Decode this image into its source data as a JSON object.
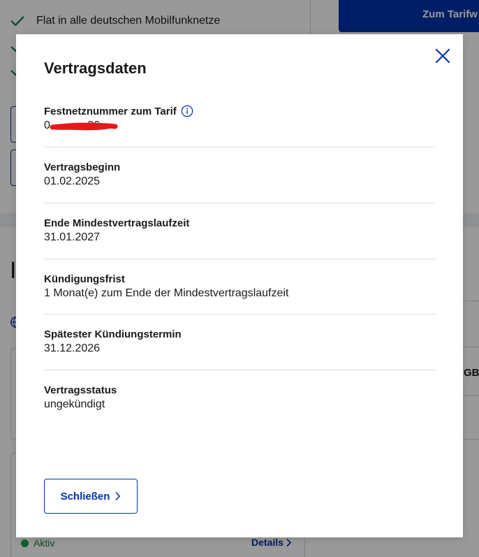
{
  "background": {
    "features": [
      "Flat in alle deutschen Mobilfunknetze"
    ],
    "tariff_button_label": "Zum Tarifw",
    "heading_fragment": "I",
    "gb_fragment": "GB",
    "status_label": "Aktiv",
    "details_link": "Details"
  },
  "modal": {
    "title": "Vertragsdaten",
    "fields": [
      {
        "label": "Festnetznummer zum Tarif",
        "value": "0            26"
      },
      {
        "label": "Vertragsbeginn",
        "value": "01.02.2025"
      },
      {
        "label": "Ende Mindestvertragslaufzeit",
        "value": "31.01.2027"
      },
      {
        "label": "Kündigungsfrist",
        "value": "1 Monat(e) zum Ende der Mindestvertragslaufzeit"
      },
      {
        "label": "Spätester Kündiungstermin",
        "value": "31.12.2026"
      },
      {
        "label": "Vertragsstatus",
        "value": "ungekündigt"
      }
    ],
    "close_button_label": "Schließen"
  },
  "colors": {
    "brand_blue": "#0033a9",
    "check_green": "#1a7f5a",
    "status_green": "#1a9e45",
    "redaction_red": "#e8161b"
  },
  "icons": {
    "close": "close-icon",
    "info": "info-icon",
    "check": "check-icon",
    "chevron": "chevron-right-icon",
    "globe": "globe-icon"
  }
}
